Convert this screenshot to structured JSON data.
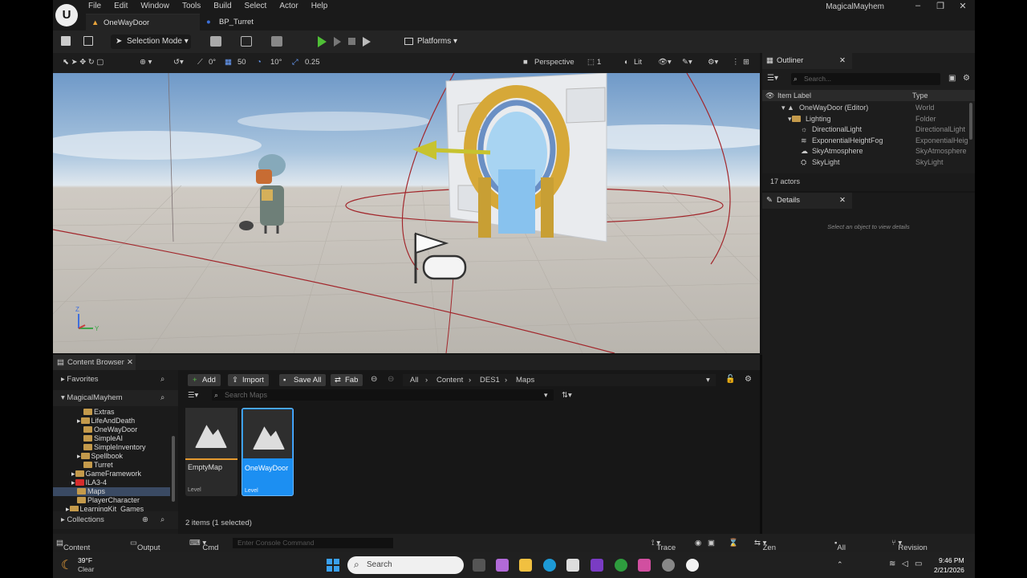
{
  "window": {
    "app_name": "MagicalMayhem",
    "menu": [
      "File",
      "Edit",
      "Window",
      "Tools",
      "Build",
      "Select",
      "Actor",
      "Help"
    ],
    "tabs": [
      "OneWayDoor",
      "BP_Turret"
    ],
    "minimize": "–",
    "maximize": "❐",
    "close": "✕"
  },
  "toolbar": {
    "mode": "Selection Mode",
    "platforms": "Platforms"
  },
  "viewport_toolbar": {
    "rotation": "0°",
    "snap_grid": "50",
    "snap_angle": "10°",
    "snap_scale": "0.25",
    "view": "Perspective",
    "speed": "1",
    "lit": "Lit",
    "axis_z": "Z",
    "axis_y": "Y"
  },
  "outliner": {
    "title": "Outliner",
    "search_placeholder": "Search...",
    "col_label": "Item Label",
    "col_type": "Type",
    "rows": [
      {
        "label": "OneWayDoor (Editor)",
        "type": "World"
      },
      {
        "label": "Lighting",
        "type": "Folder"
      },
      {
        "label": "DirectionalLight",
        "type": "DirectionalLight"
      },
      {
        "label": "ExponentialHeightFog",
        "type": "ExponentialHeig"
      },
      {
        "label": "SkyAtmosphere",
        "type": "SkyAtmosphere"
      },
      {
        "label": "SkyLight",
        "type": "SkyLight"
      }
    ],
    "actor_count": "17 actors"
  },
  "details": {
    "title": "Details",
    "empty_message": "Select an object to view details"
  },
  "content_browser": {
    "tab": "Content Browser",
    "favorites": "Favorites",
    "project": "MagicalMayhem",
    "tree": [
      {
        "label": "Extras",
        "red": false
      },
      {
        "label": "LifeAndDeath",
        "red": false
      },
      {
        "label": "OneWayDoor",
        "red": false
      },
      {
        "label": "SimpleAI",
        "red": false
      },
      {
        "label": "SimpleInventory",
        "red": false
      },
      {
        "label": "Spellbook",
        "red": false
      },
      {
        "label": "Turret",
        "red": false
      },
      {
        "label": "GameFramework",
        "red": false
      },
      {
        "label": "ILA3-4",
        "red": true
      },
      {
        "label": "Maps",
        "red": false
      },
      {
        "label": "PlayerCharacter",
        "red": false
      },
      {
        "label": "LearningKit_Games",
        "red": false
      }
    ],
    "collections": "Collections",
    "add": "Add",
    "import": "Import",
    "save_all": "Save All",
    "fab": "Fab",
    "breadcrumb": [
      "All",
      "Content",
      "DES1",
      "Maps"
    ],
    "search_placeholder": "Search Maps",
    "assets": [
      {
        "name": "EmptyMap",
        "kind": "Level"
      },
      {
        "name": "OneWayDoor",
        "kind": "Level"
      }
    ],
    "footer": "2 items (1 selected)"
  },
  "statusbar": {
    "content_drawer": "Content Drawer",
    "output_log": "Output Log",
    "cmd": "Cmd",
    "console_placeholder": "Enter Console Command",
    "trace": "Trace",
    "zen": "Zen Server",
    "saved": "All Saved",
    "revision": "Revision Control"
  },
  "taskbar": {
    "temp": "39°F",
    "weather": "Clear",
    "search": "Search",
    "time": "9:46 PM",
    "date": "2/21/2026"
  }
}
